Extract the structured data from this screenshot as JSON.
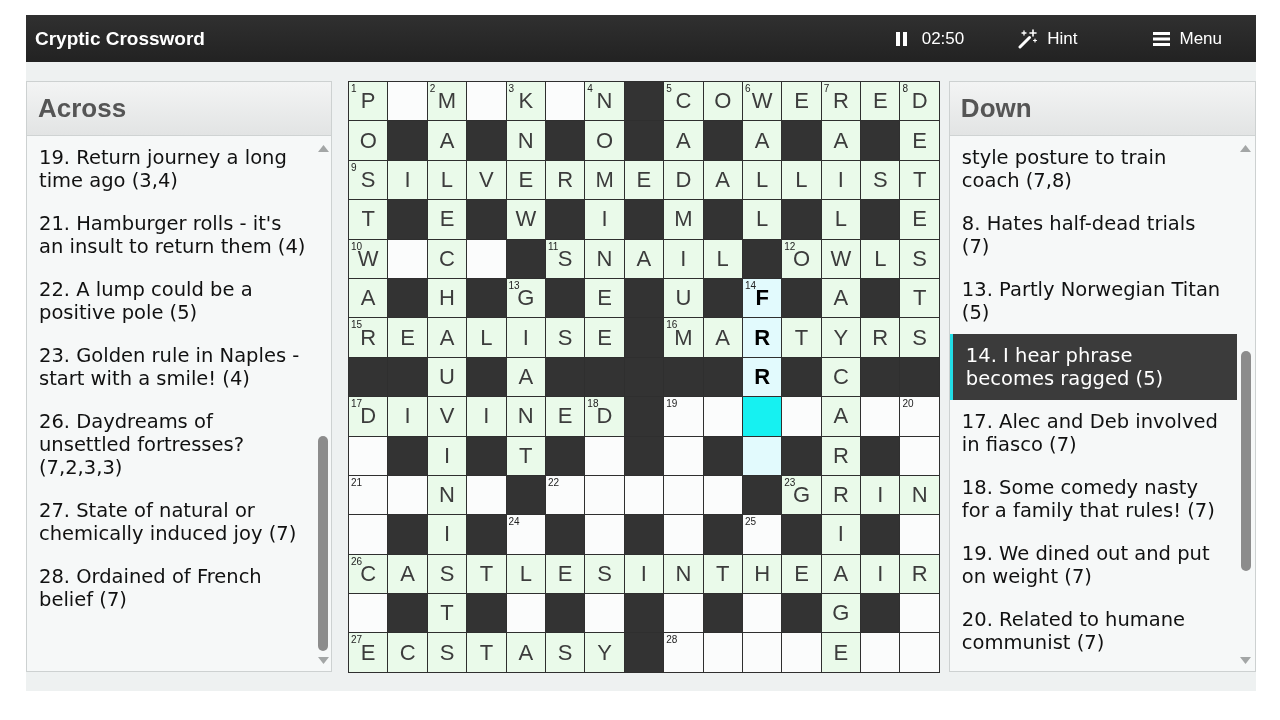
{
  "header": {
    "title": "Cryptic Crossword",
    "buttons": [
      {
        "kind": "timer",
        "label": "02:50"
      },
      {
        "kind": "hint",
        "label": "Hint"
      },
      {
        "kind": "menu",
        "label": "Menu"
      }
    ]
  },
  "across": {
    "title": "Across",
    "clues": [
      {
        "text": "19. Return journey a long time ago (3,4)",
        "selected": false
      },
      {
        "text": "21. Hamburger rolls - it's an insult to return them (4)",
        "selected": false
      },
      {
        "text": "22. A lump could be a positive pole (5)",
        "selected": false
      },
      {
        "text": "23. Golden rule in Naples - start with a smile! (4)",
        "selected": false
      },
      {
        "text": "26. Daydreams of unsettled fortresses? (7,2,3,3)",
        "selected": false
      },
      {
        "text": "27. State of natural or chemically induced joy (7)",
        "selected": false
      },
      {
        "text": "28. Ordained of French belief (7)",
        "selected": false
      }
    ]
  },
  "grid": {
    "rows": [
      [
        {
          "kind": "open",
          "number": "1",
          "letter": "P",
          "solved": true,
          "highlighted": false,
          "selected": false
        },
        {
          "kind": "open",
          "solved": false,
          "highlighted": false,
          "selected": false
        },
        {
          "kind": "open",
          "number": "2",
          "letter": "M",
          "solved": true,
          "highlighted": false,
          "selected": false
        },
        {
          "kind": "open",
          "solved": false,
          "highlighted": false,
          "selected": false
        },
        {
          "kind": "open",
          "number": "3",
          "letter": "K",
          "solved": true,
          "highlighted": false,
          "selected": false
        },
        {
          "kind": "open",
          "solved": false,
          "highlighted": false,
          "selected": false
        },
        {
          "kind": "open",
          "number": "4",
          "letter": "N",
          "solved": true,
          "highlighted": false,
          "selected": false
        },
        {
          "kind": "block"
        },
        {
          "kind": "open",
          "number": "5",
          "letter": "C",
          "solved": true,
          "highlighted": false,
          "selected": false
        },
        {
          "kind": "open",
          "letter": "O",
          "solved": true,
          "highlighted": false,
          "selected": false
        },
        {
          "kind": "open",
          "number": "6",
          "letter": "W",
          "solved": true,
          "highlighted": false,
          "selected": false
        },
        {
          "kind": "open",
          "letter": "E",
          "solved": true,
          "highlighted": false,
          "selected": false
        },
        {
          "kind": "open",
          "number": "7",
          "letter": "R",
          "solved": true,
          "highlighted": false,
          "selected": false
        },
        {
          "kind": "open",
          "letter": "E",
          "solved": true,
          "highlighted": false,
          "selected": false
        },
        {
          "kind": "open",
          "number": "8",
          "letter": "D",
          "solved": true,
          "highlighted": false,
          "selected": false
        }
      ],
      [
        {
          "kind": "open",
          "letter": "O",
          "solved": true,
          "highlighted": false,
          "selected": false
        },
        {
          "kind": "block"
        },
        {
          "kind": "open",
          "letter": "A",
          "solved": true,
          "highlighted": false,
          "selected": false
        },
        {
          "kind": "block"
        },
        {
          "kind": "open",
          "letter": "N",
          "solved": true,
          "highlighted": false,
          "selected": false
        },
        {
          "kind": "block"
        },
        {
          "kind": "open",
          "letter": "O",
          "solved": true,
          "highlighted": false,
          "selected": false
        },
        {
          "kind": "block"
        },
        {
          "kind": "open",
          "letter": "A",
          "solved": true,
          "highlighted": false,
          "selected": false
        },
        {
          "kind": "block"
        },
        {
          "kind": "open",
          "letter": "A",
          "solved": true,
          "highlighted": false,
          "selected": false
        },
        {
          "kind": "block"
        },
        {
          "kind": "open",
          "letter": "A",
          "solved": true,
          "highlighted": false,
          "selected": false
        },
        {
          "kind": "block"
        },
        {
          "kind": "open",
          "letter": "E",
          "solved": true,
          "highlighted": false,
          "selected": false
        }
      ],
      [
        {
          "kind": "open",
          "number": "9",
          "letter": "S",
          "solved": true,
          "highlighted": false,
          "selected": false
        },
        {
          "kind": "open",
          "letter": "I",
          "solved": true,
          "highlighted": false,
          "selected": false
        },
        {
          "kind": "open",
          "letter": "L",
          "solved": true,
          "highlighted": false,
          "selected": false
        },
        {
          "kind": "open",
          "letter": "V",
          "solved": true,
          "highlighted": false,
          "selected": false
        },
        {
          "kind": "open",
          "letter": "E",
          "solved": true,
          "highlighted": false,
          "selected": false
        },
        {
          "kind": "open",
          "letter": "R",
          "solved": true,
          "highlighted": false,
          "selected": false
        },
        {
          "kind": "open",
          "letter": "M",
          "solved": true,
          "highlighted": false,
          "selected": false
        },
        {
          "kind": "open",
          "letter": "E",
          "solved": true,
          "highlighted": false,
          "selected": false
        },
        {
          "kind": "open",
          "letter": "D",
          "solved": true,
          "highlighted": false,
          "selected": false
        },
        {
          "kind": "open",
          "letter": "A",
          "solved": true,
          "highlighted": false,
          "selected": false
        },
        {
          "kind": "open",
          "letter": "L",
          "solved": true,
          "highlighted": false,
          "selected": false
        },
        {
          "kind": "open",
          "letter": "L",
          "solved": true,
          "highlighted": false,
          "selected": false
        },
        {
          "kind": "open",
          "letter": "I",
          "solved": true,
          "highlighted": false,
          "selected": false
        },
        {
          "kind": "open",
          "letter": "S",
          "solved": true,
          "highlighted": false,
          "selected": false
        },
        {
          "kind": "open",
          "letter": "T",
          "solved": true,
          "highlighted": false,
          "selected": false
        }
      ],
      [
        {
          "kind": "open",
          "letter": "T",
          "solved": true,
          "highlighted": false,
          "selected": false
        },
        {
          "kind": "block"
        },
        {
          "kind": "open",
          "letter": "E",
          "solved": true,
          "highlighted": false,
          "selected": false
        },
        {
          "kind": "block"
        },
        {
          "kind": "open",
          "letter": "W",
          "solved": true,
          "highlighted": false,
          "selected": false
        },
        {
          "kind": "block"
        },
        {
          "kind": "open",
          "letter": "I",
          "solved": true,
          "highlighted": false,
          "selected": false
        },
        {
          "kind": "block"
        },
        {
          "kind": "open",
          "letter": "M",
          "solved": true,
          "highlighted": false,
          "selected": false
        },
        {
          "kind": "block"
        },
        {
          "kind": "open",
          "letter": "L",
          "solved": true,
          "highlighted": false,
          "selected": false
        },
        {
          "kind": "block"
        },
        {
          "kind": "open",
          "letter": "L",
          "solved": true,
          "highlighted": false,
          "selected": false
        },
        {
          "kind": "block"
        },
        {
          "kind": "open",
          "letter": "E",
          "solved": true,
          "highlighted": false,
          "selected": false
        }
      ],
      [
        {
          "kind": "open",
          "number": "10",
          "letter": "W",
          "solved": true,
          "highlighted": false,
          "selected": false
        },
        {
          "kind": "open",
          "solved": false,
          "highlighted": false,
          "selected": false
        },
        {
          "kind": "open",
          "letter": "C",
          "solved": true,
          "highlighted": false,
          "selected": false
        },
        {
          "kind": "open",
          "solved": false,
          "highlighted": false,
          "selected": false
        },
        {
          "kind": "block"
        },
        {
          "kind": "open",
          "number": "11",
          "letter": "S",
          "solved": true,
          "highlighted": false,
          "selected": false
        },
        {
          "kind": "open",
          "letter": "N",
          "solved": true,
          "highlighted": false,
          "selected": false
        },
        {
          "kind": "open",
          "letter": "A",
          "solved": true,
          "highlighted": false,
          "selected": false
        },
        {
          "kind": "open",
          "letter": "I",
          "solved": true,
          "highlighted": false,
          "selected": false
        },
        {
          "kind": "open",
          "letter": "L",
          "solved": true,
          "highlighted": false,
          "selected": false
        },
        {
          "kind": "block"
        },
        {
          "kind": "open",
          "number": "12",
          "letter": "O",
          "solved": true,
          "highlighted": false,
          "selected": false
        },
        {
          "kind": "open",
          "letter": "W",
          "solved": true,
          "highlighted": false,
          "selected": false
        },
        {
          "kind": "open",
          "letter": "L",
          "solved": true,
          "highlighted": false,
          "selected": false
        },
        {
          "kind": "open",
          "letter": "S",
          "solved": true,
          "highlighted": false,
          "selected": false
        }
      ],
      [
        {
          "kind": "open",
          "letter": "A",
          "solved": true,
          "highlighted": false,
          "selected": false
        },
        {
          "kind": "block"
        },
        {
          "kind": "open",
          "letter": "H",
          "solved": true,
          "highlighted": false,
          "selected": false
        },
        {
          "kind": "block"
        },
        {
          "kind": "open",
          "number": "13",
          "letter": "G",
          "solved": true,
          "highlighted": false,
          "selected": false
        },
        {
          "kind": "block"
        },
        {
          "kind": "open",
          "letter": "E",
          "solved": true,
          "highlighted": false,
          "selected": false
        },
        {
          "kind": "block"
        },
        {
          "kind": "open",
          "letter": "U",
          "solved": true,
          "highlighted": false,
          "selected": false
        },
        {
          "kind": "block"
        },
        {
          "kind": "open",
          "number": "14",
          "letter": "F",
          "solved": false,
          "highlighted": true,
          "selected": false
        },
        {
          "kind": "block"
        },
        {
          "kind": "open",
          "letter": "A",
          "solved": true,
          "highlighted": false,
          "selected": false
        },
        {
          "kind": "block"
        },
        {
          "kind": "open",
          "letter": "T",
          "solved": true,
          "highlighted": false,
          "selected": false
        }
      ],
      [
        {
          "kind": "open",
          "number": "15",
          "letter": "R",
          "solved": true,
          "highlighted": false,
          "selected": false
        },
        {
          "kind": "open",
          "letter": "E",
          "solved": true,
          "highlighted": false,
          "selected": false
        },
        {
          "kind": "open",
          "letter": "A",
          "solved": true,
          "highlighted": false,
          "selected": false
        },
        {
          "kind": "open",
          "letter": "L",
          "solved": true,
          "highlighted": false,
          "selected": false
        },
        {
          "kind": "open",
          "letter": "I",
          "solved": true,
          "highlighted": false,
          "selected": false
        },
        {
          "kind": "open",
          "letter": "S",
          "solved": true,
          "highlighted": false,
          "selected": false
        },
        {
          "kind": "open",
          "letter": "E",
          "solved": true,
          "highlighted": false,
          "selected": false
        },
        {
          "kind": "block"
        },
        {
          "kind": "open",
          "number": "16",
          "letter": "M",
          "solved": true,
          "highlighted": false,
          "selected": false
        },
        {
          "kind": "open",
          "letter": "A",
          "solved": true,
          "highlighted": false,
          "selected": false
        },
        {
          "kind": "open",
          "letter": "R",
          "solved": false,
          "highlighted": true,
          "selected": false
        },
        {
          "kind": "open",
          "letter": "T",
          "solved": true,
          "highlighted": false,
          "selected": false
        },
        {
          "kind": "open",
          "letter": "Y",
          "solved": true,
          "highlighted": false,
          "selected": false
        },
        {
          "kind": "open",
          "letter": "R",
          "solved": true,
          "highlighted": false,
          "selected": false
        },
        {
          "kind": "open",
          "letter": "S",
          "solved": true,
          "highlighted": false,
          "selected": false
        }
      ],
      [
        {
          "kind": "block"
        },
        {
          "kind": "block"
        },
        {
          "kind": "open",
          "letter": "U",
          "solved": true,
          "highlighted": false,
          "selected": false
        },
        {
          "kind": "block"
        },
        {
          "kind": "open",
          "letter": "A",
          "solved": true,
          "highlighted": false,
          "selected": false
        },
        {
          "kind": "block"
        },
        {
          "kind": "block"
        },
        {
          "kind": "block"
        },
        {
          "kind": "block"
        },
        {
          "kind": "block"
        },
        {
          "kind": "open",
          "letter": "R",
          "solved": false,
          "highlighted": true,
          "selected": false
        },
        {
          "kind": "block"
        },
        {
          "kind": "open",
          "letter": "C",
          "solved": true,
          "highlighted": false,
          "selected": false
        },
        {
          "kind": "block"
        },
        {
          "kind": "block"
        }
      ],
      [
        {
          "kind": "open",
          "number": "17",
          "letter": "D",
          "solved": true,
          "highlighted": false,
          "selected": false
        },
        {
          "kind": "open",
          "letter": "I",
          "solved": true,
          "highlighted": false,
          "selected": false
        },
        {
          "kind": "open",
          "letter": "V",
          "solved": true,
          "highlighted": false,
          "selected": false
        },
        {
          "kind": "open",
          "letter": "I",
          "solved": true,
          "highlighted": false,
          "selected": false
        },
        {
          "kind": "open",
          "letter": "N",
          "solved": true,
          "highlighted": false,
          "selected": false
        },
        {
          "kind": "open",
          "letter": "E",
          "solved": true,
          "highlighted": false,
          "selected": false
        },
        {
          "kind": "open",
          "number": "18",
          "letter": "D",
          "solved": true,
          "highlighted": false,
          "selected": false
        },
        {
          "kind": "block"
        },
        {
          "kind": "open",
          "number": "19",
          "solved": false,
          "highlighted": false,
          "selected": false
        },
        {
          "kind": "open",
          "solved": false,
          "highlighted": false,
          "selected": false
        },
        {
          "kind": "open",
          "solved": false,
          "highlighted": true,
          "selected": true
        },
        {
          "kind": "open",
          "solved": false,
          "highlighted": false,
          "selected": false
        },
        {
          "kind": "open",
          "letter": "A",
          "solved": true,
          "highlighted": false,
          "selected": false
        },
        {
          "kind": "open",
          "solved": false,
          "highlighted": false,
          "selected": false
        },
        {
          "kind": "open",
          "number": "20",
          "solved": false,
          "highlighted": false,
          "selected": false
        }
      ],
      [
        {
          "kind": "open",
          "solved": false,
          "highlighted": false,
          "selected": false
        },
        {
          "kind": "block"
        },
        {
          "kind": "open",
          "letter": "I",
          "solved": true,
          "highlighted": false,
          "selected": false
        },
        {
          "kind": "block"
        },
        {
          "kind": "open",
          "letter": "T",
          "solved": true,
          "highlighted": false,
          "selected": false
        },
        {
          "kind": "block"
        },
        {
          "kind": "open",
          "solved": false,
          "highlighted": false,
          "selected": false
        },
        {
          "kind": "block"
        },
        {
          "kind": "open",
          "solved": false,
          "highlighted": false,
          "selected": false
        },
        {
          "kind": "block"
        },
        {
          "kind": "open",
          "solved": false,
          "highlighted": true,
          "selected": false
        },
        {
          "kind": "block"
        },
        {
          "kind": "open",
          "letter": "R",
          "solved": true,
          "highlighted": false,
          "selected": false
        },
        {
          "kind": "block"
        },
        {
          "kind": "open",
          "solved": false,
          "highlighted": false,
          "selected": false
        }
      ],
      [
        {
          "kind": "open",
          "number": "21",
          "solved": false,
          "highlighted": false,
          "selected": false
        },
        {
          "kind": "open",
          "solved": false,
          "highlighted": false,
          "selected": false
        },
        {
          "kind": "open",
          "letter": "N",
          "solved": true,
          "highlighted": false,
          "selected": false
        },
        {
          "kind": "open",
          "solved": false,
          "highlighted": false,
          "selected": false
        },
        {
          "kind": "block"
        },
        {
          "kind": "open",
          "number": "22",
          "solved": false,
          "highlighted": false,
          "selected": false
        },
        {
          "kind": "open",
          "solved": false,
          "highlighted": false,
          "selected": false
        },
        {
          "kind": "open",
          "solved": false,
          "highlighted": false,
          "selected": false
        },
        {
          "kind": "open",
          "solved": false,
          "highlighted": false,
          "selected": false
        },
        {
          "kind": "open",
          "solved": false,
          "highlighted": false,
          "selected": false
        },
        {
          "kind": "block"
        },
        {
          "kind": "open",
          "number": "23",
          "letter": "G",
          "solved": true,
          "highlighted": false,
          "selected": false
        },
        {
          "kind": "open",
          "letter": "R",
          "solved": true,
          "highlighted": false,
          "selected": false
        },
        {
          "kind": "open",
          "letter": "I",
          "solved": true,
          "highlighted": false,
          "selected": false
        },
        {
          "kind": "open",
          "letter": "N",
          "solved": true,
          "highlighted": false,
          "selected": false
        }
      ],
      [
        {
          "kind": "open",
          "solved": false,
          "highlighted": false,
          "selected": false
        },
        {
          "kind": "block"
        },
        {
          "kind": "open",
          "letter": "I",
          "solved": true,
          "highlighted": false,
          "selected": false
        },
        {
          "kind": "block"
        },
        {
          "kind": "open",
          "number": "24",
          "solved": false,
          "highlighted": false,
          "selected": false
        },
        {
          "kind": "block"
        },
        {
          "kind": "open",
          "solved": false,
          "highlighted": false,
          "selected": false
        },
        {
          "kind": "block"
        },
        {
          "kind": "open",
          "solved": false,
          "highlighted": false,
          "selected": false
        },
        {
          "kind": "block"
        },
        {
          "kind": "open",
          "number": "25",
          "solved": false,
          "highlighted": false,
          "selected": false
        },
        {
          "kind": "block"
        },
        {
          "kind": "open",
          "letter": "I",
          "solved": true,
          "highlighted": false,
          "selected": false
        },
        {
          "kind": "block"
        },
        {
          "kind": "open",
          "solved": false,
          "highlighted": false,
          "selected": false
        }
      ],
      [
        {
          "kind": "open",
          "number": "26",
          "letter": "C",
          "solved": true,
          "highlighted": false,
          "selected": false
        },
        {
          "kind": "open",
          "letter": "A",
          "solved": true,
          "highlighted": false,
          "selected": false
        },
        {
          "kind": "open",
          "letter": "S",
          "solved": true,
          "highlighted": false,
          "selected": false
        },
        {
          "kind": "open",
          "letter": "T",
          "solved": true,
          "highlighted": false,
          "selected": false
        },
        {
          "kind": "open",
          "letter": "L",
          "solved": true,
          "highlighted": false,
          "selected": false
        },
        {
          "kind": "open",
          "letter": "E",
          "solved": true,
          "highlighted": false,
          "selected": false
        },
        {
          "kind": "open",
          "letter": "S",
          "solved": true,
          "highlighted": false,
          "selected": false
        },
        {
          "kind": "open",
          "letter": "I",
          "solved": true,
          "highlighted": false,
          "selected": false
        },
        {
          "kind": "open",
          "letter": "N",
          "solved": true,
          "highlighted": false,
          "selected": false
        },
        {
          "kind": "open",
          "letter": "T",
          "solved": true,
          "highlighted": false,
          "selected": false
        },
        {
          "kind": "open",
          "letter": "H",
          "solved": true,
          "highlighted": false,
          "selected": false
        },
        {
          "kind": "open",
          "letter": "E",
          "solved": true,
          "highlighted": false,
          "selected": false
        },
        {
          "kind": "open",
          "letter": "A",
          "solved": true,
          "highlighted": false,
          "selected": false
        },
        {
          "kind": "open",
          "letter": "I",
          "solved": true,
          "highlighted": false,
          "selected": false
        },
        {
          "kind": "open",
          "letter": "R",
          "solved": true,
          "highlighted": false,
          "selected": false
        }
      ],
      [
        {
          "kind": "open",
          "solved": false,
          "highlighted": false,
          "selected": false
        },
        {
          "kind": "block"
        },
        {
          "kind": "open",
          "letter": "T",
          "solved": true,
          "highlighted": false,
          "selected": false
        },
        {
          "kind": "block"
        },
        {
          "kind": "open",
          "solved": false,
          "highlighted": false,
          "selected": false
        },
        {
          "kind": "block"
        },
        {
          "kind": "open",
          "solved": false,
          "highlighted": false,
          "selected": false
        },
        {
          "kind": "block"
        },
        {
          "kind": "open",
          "solved": false,
          "highlighted": false,
          "selected": false
        },
        {
          "kind": "block"
        },
        {
          "kind": "open",
          "solved": false,
          "highlighted": false,
          "selected": false
        },
        {
          "kind": "block"
        },
        {
          "kind": "open",
          "letter": "G",
          "solved": true,
          "highlighted": false,
          "selected": false
        },
        {
          "kind": "block"
        },
        {
          "kind": "open",
          "solved": false,
          "highlighted": false,
          "selected": false
        }
      ],
      [
        {
          "kind": "open",
          "number": "27",
          "letter": "E",
          "solved": true,
          "highlighted": false,
          "selected": false
        },
        {
          "kind": "open",
          "letter": "C",
          "solved": true,
          "highlighted": false,
          "selected": false
        },
        {
          "kind": "open",
          "letter": "S",
          "solved": true,
          "highlighted": false,
          "selected": false
        },
        {
          "kind": "open",
          "letter": "T",
          "solved": true,
          "highlighted": false,
          "selected": false
        },
        {
          "kind": "open",
          "letter": "A",
          "solved": true,
          "highlighted": false,
          "selected": false
        },
        {
          "kind": "open",
          "letter": "S",
          "solved": true,
          "highlighted": false,
          "selected": false
        },
        {
          "kind": "open",
          "letter": "Y",
          "solved": true,
          "highlighted": false,
          "selected": false
        },
        {
          "kind": "block"
        },
        {
          "kind": "open",
          "number": "28",
          "solved": false,
          "highlighted": false,
          "selected": false
        },
        {
          "kind": "open",
          "solved": false,
          "highlighted": false,
          "selected": false
        },
        {
          "kind": "open",
          "solved": false,
          "highlighted": false,
          "selected": false
        },
        {
          "kind": "open",
          "solved": false,
          "highlighted": false,
          "selected": false
        },
        {
          "kind": "open",
          "letter": "E",
          "solved": true,
          "highlighted": false,
          "selected": false
        },
        {
          "kind": "open",
          "solved": false,
          "highlighted": false,
          "selected": false
        },
        {
          "kind": "open",
          "solved": false,
          "highlighted": false,
          "selected": false
        }
      ]
    ]
  },
  "down": {
    "title": "Down",
    "clues": [
      {
        "text": "style posture to train coach (7,8)",
        "selected": false
      },
      {
        "text": "8. Hates half-dead trials (7)",
        "selected": false
      },
      {
        "text": "13. Partly Norwegian Titan (5)",
        "selected": false
      },
      {
        "text": "14. I hear phrase becomes ragged (5)",
        "selected": true
      },
      {
        "text": "17. Alec and Deb involved in fiasco (7)",
        "selected": false
      },
      {
        "text": "18. Some comedy nasty for a family that rules! (7)",
        "selected": false
      },
      {
        "text": "19. We dined out and put on weight (7)",
        "selected": false
      },
      {
        "text": "20. Related to humane communist (7)",
        "selected": false
      }
    ]
  }
}
